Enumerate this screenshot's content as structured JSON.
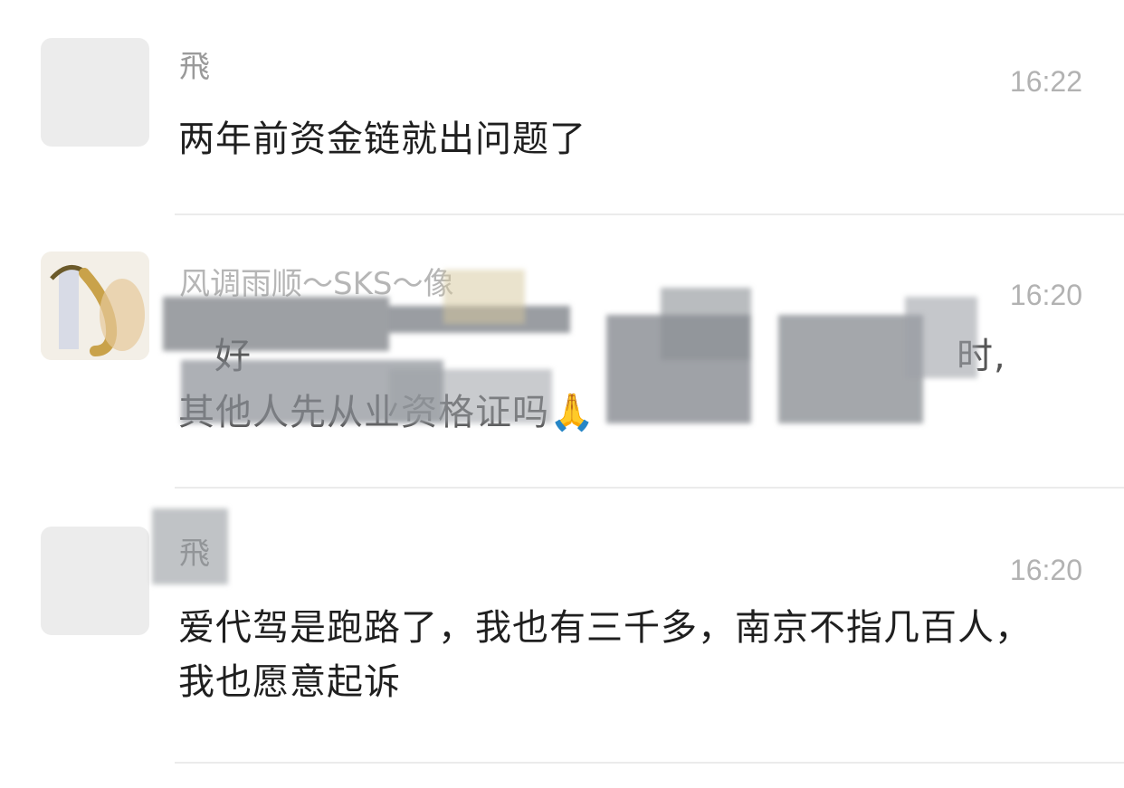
{
  "conversations": [
    {
      "name": "飛",
      "time": "16:22",
      "message": "两年前资金链就出问题了"
    },
    {
      "name": "风调雨顺～SKS～像",
      "time": "16:20",
      "message_line1": "好",
      "message_line1_end": "时,",
      "message_line2": "其他人先从业资格证吗🙏"
    },
    {
      "name": "飛",
      "time": "16:20",
      "message": "爱代驾是跑路了，我也有三千多，南京不指几百人，我也愿意起诉"
    }
  ],
  "colors": {
    "background": "#ffffff",
    "name": "#9a9a9a",
    "time": "#b2b2b2",
    "message": "#1f1f1f",
    "divider": "#ebebeb",
    "avatar_placeholder": "#ececec"
  }
}
